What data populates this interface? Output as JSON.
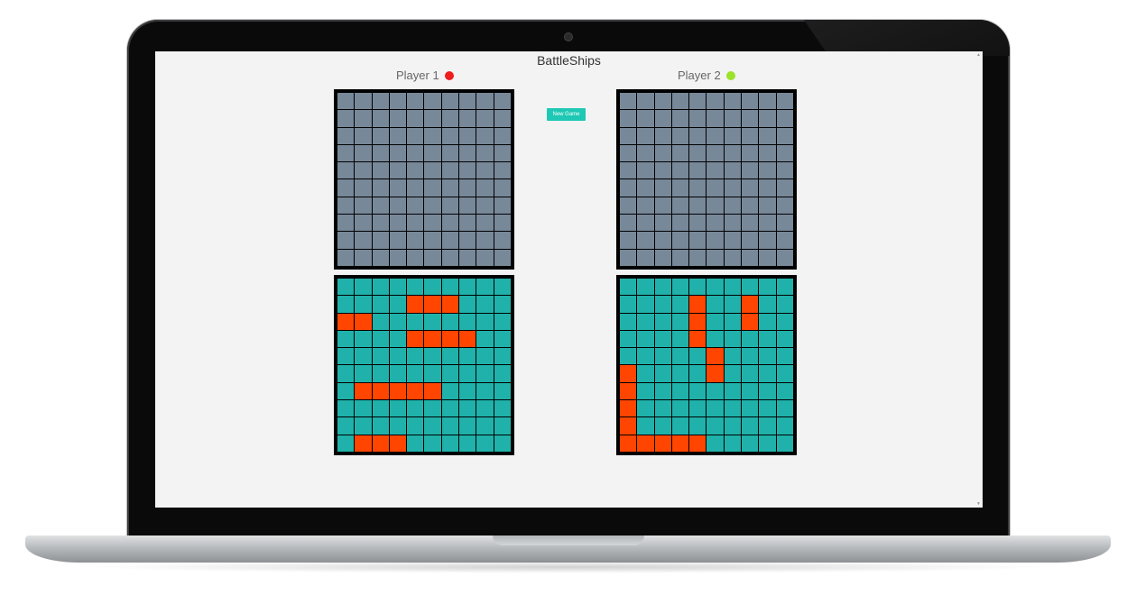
{
  "app": {
    "title": "BattleShips",
    "new_game_label": "New Game"
  },
  "players": [
    {
      "label": "Player 1",
      "status_color": "#ee1c1c"
    },
    {
      "label": "Player 2",
      "status_color": "#9be22a"
    }
  ],
  "colors": {
    "accent": "#1ec8b4",
    "unknown_cell": "#778899",
    "water_cell": "#20b2aa",
    "ship_cell": "#ff4500"
  },
  "boards": {
    "p1_target": [
      "0000000000",
      "0000000000",
      "0000000000",
      "0000000000",
      "0000000000",
      "0000000000",
      "0000000000",
      "0000000000",
      "0000000000",
      "0000000000"
    ],
    "p2_target": [
      "0000000000",
      "0000000000",
      "0000000000",
      "0000000000",
      "0000000000",
      "0000000000",
      "0000000000",
      "0000000000",
      "0000000000",
      "0000000000"
    ],
    "p1_fleet": [
      "0000000000",
      "0000111000",
      "1100000000",
      "0000111100",
      "0000000000",
      "0000000000",
      "0111110000",
      "0000000000",
      "0000000000",
      "0111000000"
    ],
    "p2_fleet": [
      "0000000000",
      "0000100100",
      "0000100100",
      "0000100000",
      "0000010000",
      "1000010000",
      "1000000000",
      "1000000000",
      "1000000000",
      "1111100000"
    ]
  }
}
